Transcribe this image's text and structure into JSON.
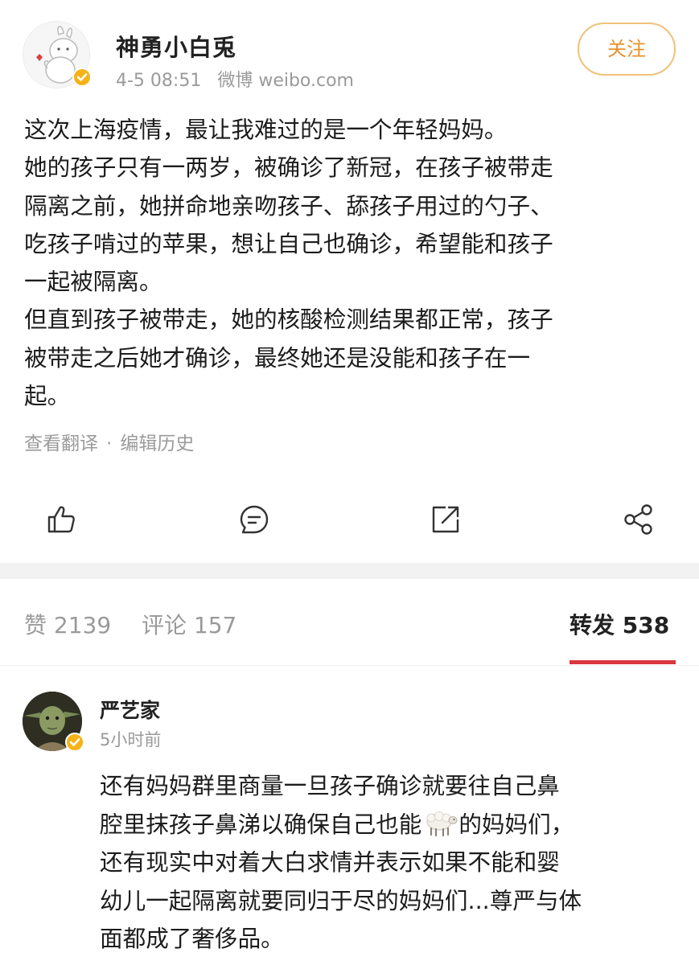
{
  "post": {
    "author": "神勇小白兎",
    "time": "4-5 08:51",
    "source": "微博 weibo.com",
    "follow_label": "关注",
    "lines": [
      "这次上海疫情，最让我难过的是一个年轻妈妈。",
      "她的孩子只有一两岁，被确诊了新冠，在孩子被带走",
      "隔离之前，她拼命地亲吻孩子、舔孩子用过的勺子、",
      "吃孩子啃过的苹果，想让自己也确诊，希望能和孩子",
      "一起被隔离。",
      "但直到孩子被带走，她的核酸检测结果都正常，孩子",
      "被带走之后她才确诊，最终她还是没能和孩子在一",
      "起。"
    ],
    "translate_label": "查看翻译",
    "separator": "·",
    "edit_history_label": "编辑历史",
    "actions": {
      "like_icon": "thumbs-up-icon",
      "comment_icon": "comment-icon",
      "repost_icon": "repost-icon",
      "share_icon": "share-icon"
    }
  },
  "tabs": {
    "likes": "赞 2139",
    "comments": "评论 157",
    "reposts": "转发 538",
    "active_color": "#d9363e"
  },
  "comment": {
    "author": "严艺家",
    "time": "5小时前",
    "line1": "还有妈妈群里商量一旦孩子确诊就要往自己鼻",
    "line2_before": "腔里抹孩子鼻涕以确保自己也能",
    "line2_emoji": "sheep-emoji",
    "line2_after": "的妈妈们，",
    "line3": "还有现实中对着大白求情并表示如果不能和婴",
    "line4": "幼儿一起隔离就要同归于尽的妈妈们...尊严与体",
    "line5": "面都成了奢侈品。"
  },
  "colors": {
    "follow_text": "#e8922d",
    "follow_border": "#f0c27a",
    "verified_badge": "#f5b318"
  }
}
